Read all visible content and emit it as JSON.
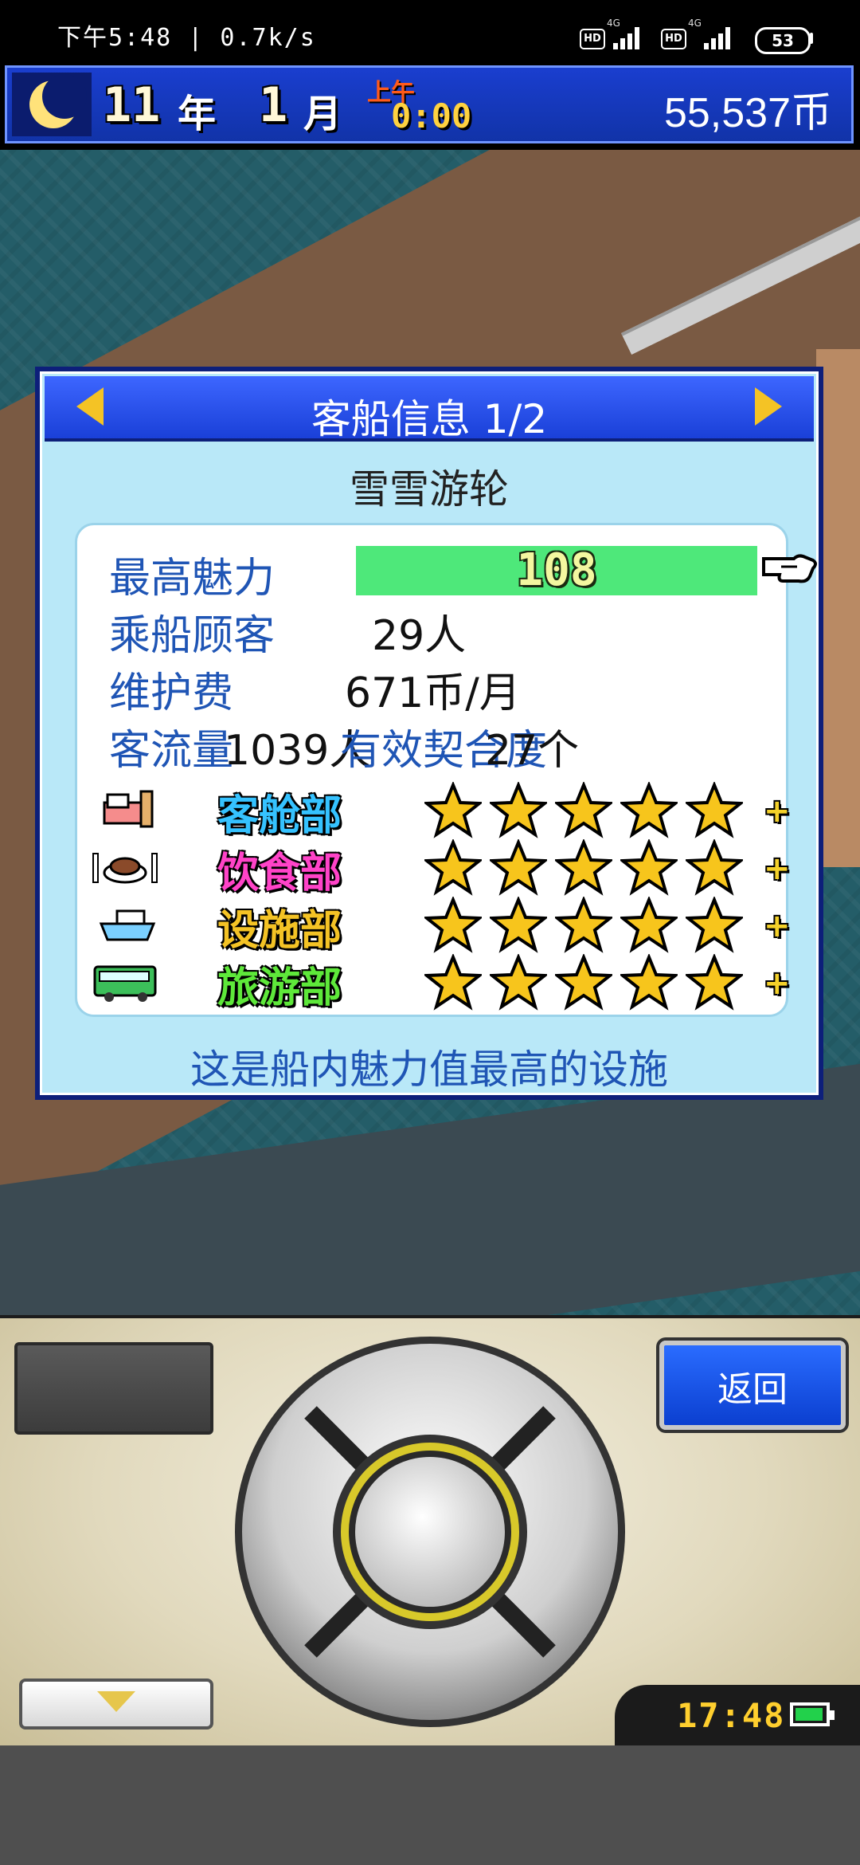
{
  "status_bar": {
    "time_speed": "下午5:48 | 0.7k/s",
    "hd_label": "HD",
    "network_label": "4G",
    "battery_level": "53"
  },
  "game_header": {
    "year_number": "11",
    "year_unit": "年",
    "month_number": "1",
    "month_unit": "月",
    "ampm": "上午",
    "time": "0:00",
    "money": "55,537币",
    "moon_icon": "crescent-moon-icon"
  },
  "panel": {
    "title": "客船信息 1/2",
    "ship_name": "雪雪游轮",
    "stats": {
      "max_charm_label": "最高魅力",
      "max_charm_value": "108",
      "passengers_label": "乘船顾客",
      "passengers_value": "29人",
      "maintenance_label": "维护费",
      "maintenance_value": "671币/月",
      "traffic_label": "客流量",
      "traffic_value": "1039人",
      "combo_label": "有效契合度",
      "combo_value": "27个"
    },
    "departments": [
      {
        "name": "客舱部",
        "color": "#35c2ff",
        "icon": "bed-icon",
        "stars": 5,
        "plus": "+"
      },
      {
        "name": "饮食部",
        "color": "#ff43c8",
        "icon": "food-plate-icon",
        "stars": 5,
        "plus": "+"
      },
      {
        "name": "设施部",
        "color": "#f4c325",
        "icon": "ship-icon",
        "stars": 5,
        "plus": "+"
      },
      {
        "name": "旅游部",
        "color": "#5ee83a",
        "icon": "bus-icon",
        "stars": 5,
        "plus": "+"
      }
    ],
    "footer_note": "这是船内魅力值最高的设施"
  },
  "controller": {
    "back_label": "返回",
    "clock": "17:48"
  },
  "colors": {
    "header_blue": "#1a40d8",
    "panel_bg": "#b9e8f8",
    "label_blue": "#1f55b5",
    "charm_green": "#4ee87a",
    "star_gold": "#f7c51c"
  }
}
